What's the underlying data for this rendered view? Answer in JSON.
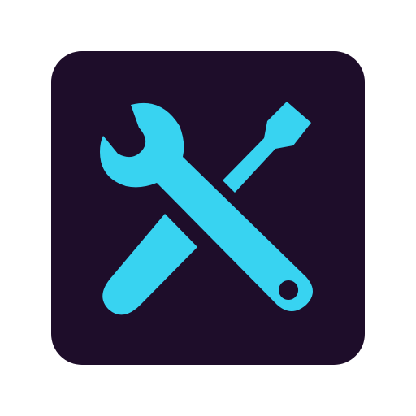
{
  "icon": {
    "name": "tools-icon",
    "parts": [
      "wrench-icon",
      "screwdriver-icon"
    ],
    "colors": {
      "background": "#1e0d2a",
      "glyph": "#38d3f1",
      "page": "#ffffff"
    }
  }
}
